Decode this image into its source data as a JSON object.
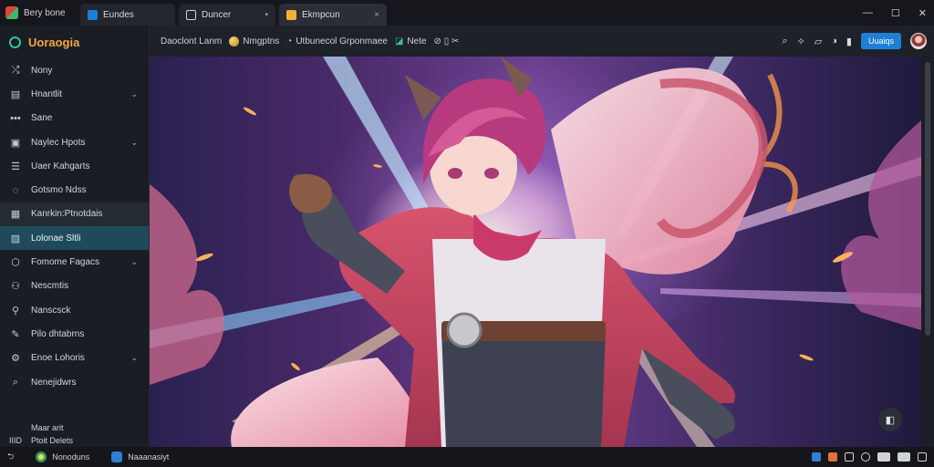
{
  "window": {
    "app_name": "Bery bone",
    "tabs": [
      {
        "label": "Eundes",
        "icon": "cloud-icon",
        "active": false
      },
      {
        "label": "Duncer",
        "icon": "document-icon",
        "active": false
      },
      {
        "label": "Ekmpcun",
        "icon": "page-icon",
        "active": true
      }
    ],
    "tab_close": "×",
    "tab_menu_dot": "•",
    "controls": {
      "minimize": "—",
      "maximize": "☐",
      "close": "✕"
    }
  },
  "sidebar": {
    "brand": "Uoraogia",
    "items": [
      {
        "label": "Nony",
        "icon": "shuffle-icon",
        "chevron": false
      },
      {
        "label": "Hnantlit",
        "icon": "book-icon",
        "chevron": true
      },
      {
        "label": "Sane",
        "icon": "dots-icon",
        "chevron": false
      },
      {
        "label": "Naylec Hpots",
        "icon": "image-icon",
        "chevron": true
      },
      {
        "label": "Uaer Kahgarts",
        "icon": "list-icon",
        "chevron": false
      },
      {
        "label": "Gotsmo Ndss",
        "icon": "chat-icon",
        "chevron": false
      },
      {
        "label": "Kanrkin:Ptnotdais",
        "icon": "card-icon",
        "chevron": false,
        "state": "highlight"
      },
      {
        "label": "Lolonae Sltli",
        "icon": "photo-icon",
        "chevron": false,
        "state": "active"
      },
      {
        "label": "Fomome Fagacs",
        "icon": "shield-icon",
        "chevron": true
      },
      {
        "label": "Nescmtis",
        "icon": "network-icon",
        "chevron": false
      },
      {
        "label": "Nanscsck",
        "icon": "share-icon",
        "chevron": false
      },
      {
        "label": "Pilo dhtabrns",
        "icon": "wrench-icon",
        "chevron": false
      },
      {
        "label": "Enoe Lohoris",
        "icon": "settings-icon",
        "chevron": true
      },
      {
        "label": "Nenejidwrs",
        "icon": "search-icon",
        "chevron": false
      }
    ],
    "footer": {
      "line1": "Maar arit",
      "line2": "Ptoit Delets",
      "line2_icon": "IIID"
    }
  },
  "toolbar": {
    "breadcrumb": {
      "item1": "Daoclont Lanm",
      "item2": "Nmgptns",
      "item3": "Utbunecol Grponmaee",
      "item4": "Nete",
      "extra_icons": "⊘ ▯ ✂"
    },
    "icons": [
      "search-icon",
      "tools-icon",
      "edit-icon",
      "contrast-icon",
      "book-icon"
    ],
    "upgrade_label": "Uuaiqs"
  },
  "taskbar": {
    "items": [
      {
        "label": "Nonoduns",
        "icon": "browser-icon"
      },
      {
        "label": "Naaanasiyt",
        "icon": "window-icon"
      }
    ],
    "start_glyph": "⮌"
  },
  "colors": {
    "accent": "#1d7fd8",
    "brand": "#f2a93b",
    "active_nav": "#1f4a5c",
    "teal": "#2ec4a5"
  }
}
